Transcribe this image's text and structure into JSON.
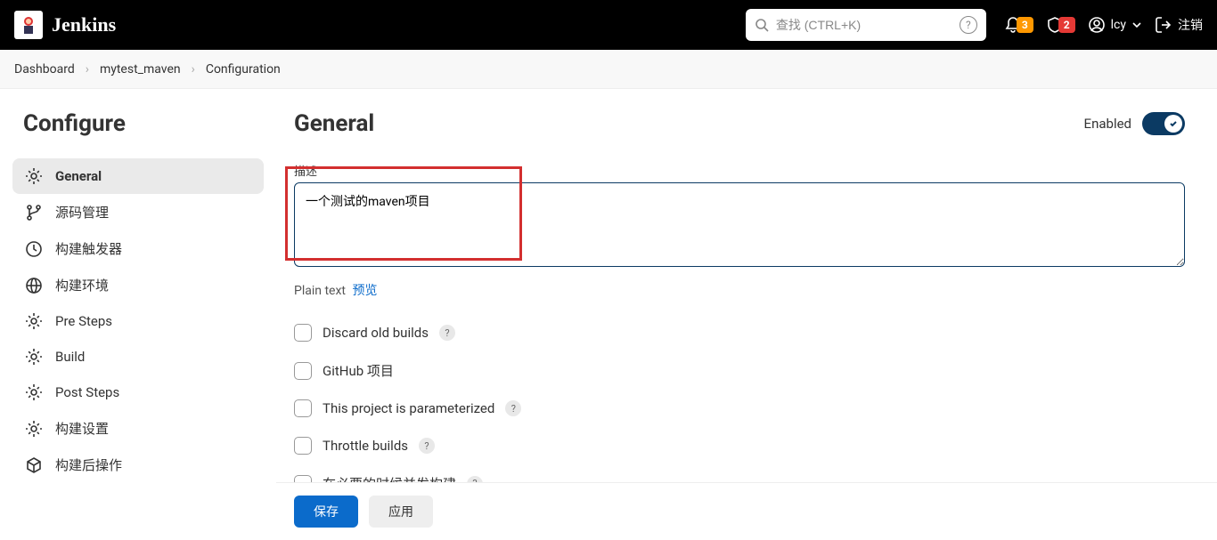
{
  "header": {
    "brand": "Jenkins",
    "search_placeholder": "查找 (CTRL+K)",
    "notif_count": "3",
    "alert_count": "2",
    "user": "lcy",
    "logout": "注销"
  },
  "breadcrumb": {
    "items": [
      "Dashboard",
      "mytest_maven",
      "Configuration"
    ]
  },
  "sidebar": {
    "title": "Configure",
    "items": [
      {
        "label": "General"
      },
      {
        "label": "源码管理"
      },
      {
        "label": "构建触发器"
      },
      {
        "label": "构建环境"
      },
      {
        "label": "Pre Steps"
      },
      {
        "label": "Build"
      },
      {
        "label": "Post Steps"
      },
      {
        "label": "构建设置"
      },
      {
        "label": "构建后操作"
      }
    ]
  },
  "main": {
    "title": "General",
    "enabled_label": "Enabled",
    "desc_label": "描述",
    "desc_value": "一个测试的maven项目",
    "hint_plain": "Plain text",
    "hint_preview": "预览",
    "options": [
      {
        "label": "Discard old builds",
        "help": true
      },
      {
        "label": "GitHub 项目",
        "help": false
      },
      {
        "label": "This project is parameterized",
        "help": true
      },
      {
        "label": "Throttle builds",
        "help": true
      },
      {
        "label": "在必要的时候并发构建",
        "help": true
      }
    ]
  },
  "footer": {
    "save": "保存",
    "apply": "应用"
  }
}
